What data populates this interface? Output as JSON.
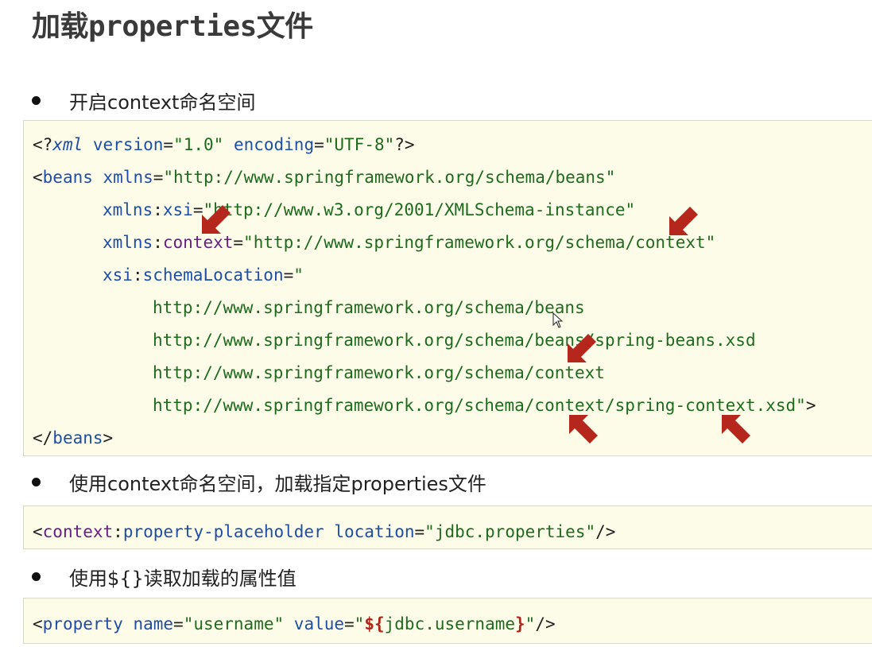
{
  "title": "加载properties文件",
  "bullets": [
    "开启context命名空间",
    "使用context命名空间，加载指定properties文件",
    "使用${}读取加载的属性值"
  ],
  "code1": {
    "line1": {
      "open": "<?",
      "pi": "xml",
      "a1": "version",
      "v1": "\"1.0\"",
      "a2": "encoding",
      "v2": "\"UTF-8\"",
      "close": "?>"
    },
    "line2": {
      "open": "<",
      "tag": "beans",
      "attr": "xmlns",
      "val": "\"http://www.springframework.org/schema/beans\""
    },
    "line3": {
      "ns": "xmlns",
      "colon": ":",
      "attr": "xsi",
      "val": "\"http://www.w3.org/2001/XMLSchema-instance\""
    },
    "line4": {
      "ns": "xmlns",
      "colon": ":",
      "attr": "context",
      "val": "\"http://www.springframework.org/schema/context\""
    },
    "line5": {
      "ns": "xsi",
      "colon": ":",
      "attr": "schemaLocation",
      "val": "\""
    },
    "line6": "http://www.springframework.org/schema/beans",
    "line7": "http://www.springframework.org/schema/beans/spring-beans.xsd",
    "line8": "http://www.springframework.org/schema/context",
    "line9": {
      "val": "http://www.springframework.org/schema/context/spring-context.xsd\"",
      "close": ">"
    },
    "line10": {
      "open": "</",
      "tag": "beans",
      "close": ">"
    }
  },
  "code2": {
    "open": "<",
    "ns": "context",
    "colon": ":",
    "tag": "property-placeholder",
    "attr": "location",
    "val": "\"jdbc.properties\"",
    "close": "/>"
  },
  "code3": {
    "open": "<",
    "tag": "property",
    "a1": "name",
    "v1": "\"username\"",
    "a2": "value",
    "q1": "\"",
    "dollar": "$",
    "lb": "{",
    "expr": "jdbc.username",
    "rb": "}",
    "q2": "\"",
    "close": "/>"
  },
  "colors": {
    "code_bg": "#fcfce9",
    "arrow": "#b5261c",
    "tag": "#1f4ea8",
    "value": "#1e6b1e",
    "namespace": "#6a1e8a"
  }
}
